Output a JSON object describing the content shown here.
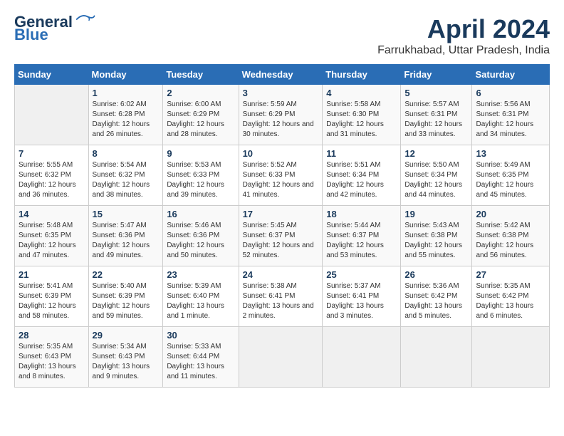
{
  "header": {
    "logo_line1": "General",
    "logo_line2": "Blue",
    "month": "April 2024",
    "location": "Farrukhabad, Uttar Pradesh, India"
  },
  "days_of_week": [
    "Sunday",
    "Monday",
    "Tuesday",
    "Wednesday",
    "Thursday",
    "Friday",
    "Saturday"
  ],
  "weeks": [
    [
      {
        "day": "",
        "empty": true
      },
      {
        "day": "1",
        "sunrise": "Sunrise: 6:02 AM",
        "sunset": "Sunset: 6:28 PM",
        "daylight": "Daylight: 12 hours and 26 minutes."
      },
      {
        "day": "2",
        "sunrise": "Sunrise: 6:00 AM",
        "sunset": "Sunset: 6:29 PM",
        "daylight": "Daylight: 12 hours and 28 minutes."
      },
      {
        "day": "3",
        "sunrise": "Sunrise: 5:59 AM",
        "sunset": "Sunset: 6:29 PM",
        "daylight": "Daylight: 12 hours and 30 minutes."
      },
      {
        "day": "4",
        "sunrise": "Sunrise: 5:58 AM",
        "sunset": "Sunset: 6:30 PM",
        "daylight": "Daylight: 12 hours and 31 minutes."
      },
      {
        "day": "5",
        "sunrise": "Sunrise: 5:57 AM",
        "sunset": "Sunset: 6:31 PM",
        "daylight": "Daylight: 12 hours and 33 minutes."
      },
      {
        "day": "6",
        "sunrise": "Sunrise: 5:56 AM",
        "sunset": "Sunset: 6:31 PM",
        "daylight": "Daylight: 12 hours and 34 minutes."
      }
    ],
    [
      {
        "day": "7",
        "sunrise": "Sunrise: 5:55 AM",
        "sunset": "Sunset: 6:32 PM",
        "daylight": "Daylight: 12 hours and 36 minutes."
      },
      {
        "day": "8",
        "sunrise": "Sunrise: 5:54 AM",
        "sunset": "Sunset: 6:32 PM",
        "daylight": "Daylight: 12 hours and 38 minutes."
      },
      {
        "day": "9",
        "sunrise": "Sunrise: 5:53 AM",
        "sunset": "Sunset: 6:33 PM",
        "daylight": "Daylight: 12 hours and 39 minutes."
      },
      {
        "day": "10",
        "sunrise": "Sunrise: 5:52 AM",
        "sunset": "Sunset: 6:33 PM",
        "daylight": "Daylight: 12 hours and 41 minutes."
      },
      {
        "day": "11",
        "sunrise": "Sunrise: 5:51 AM",
        "sunset": "Sunset: 6:34 PM",
        "daylight": "Daylight: 12 hours and 42 minutes."
      },
      {
        "day": "12",
        "sunrise": "Sunrise: 5:50 AM",
        "sunset": "Sunset: 6:34 PM",
        "daylight": "Daylight: 12 hours and 44 minutes."
      },
      {
        "day": "13",
        "sunrise": "Sunrise: 5:49 AM",
        "sunset": "Sunset: 6:35 PM",
        "daylight": "Daylight: 12 hours and 45 minutes."
      }
    ],
    [
      {
        "day": "14",
        "sunrise": "Sunrise: 5:48 AM",
        "sunset": "Sunset: 6:35 PM",
        "daylight": "Daylight: 12 hours and 47 minutes."
      },
      {
        "day": "15",
        "sunrise": "Sunrise: 5:47 AM",
        "sunset": "Sunset: 6:36 PM",
        "daylight": "Daylight: 12 hours and 49 minutes."
      },
      {
        "day": "16",
        "sunrise": "Sunrise: 5:46 AM",
        "sunset": "Sunset: 6:36 PM",
        "daylight": "Daylight: 12 hours and 50 minutes."
      },
      {
        "day": "17",
        "sunrise": "Sunrise: 5:45 AM",
        "sunset": "Sunset: 6:37 PM",
        "daylight": "Daylight: 12 hours and 52 minutes."
      },
      {
        "day": "18",
        "sunrise": "Sunrise: 5:44 AM",
        "sunset": "Sunset: 6:37 PM",
        "daylight": "Daylight: 12 hours and 53 minutes."
      },
      {
        "day": "19",
        "sunrise": "Sunrise: 5:43 AM",
        "sunset": "Sunset: 6:38 PM",
        "daylight": "Daylight: 12 hours and 55 minutes."
      },
      {
        "day": "20",
        "sunrise": "Sunrise: 5:42 AM",
        "sunset": "Sunset: 6:38 PM",
        "daylight": "Daylight: 12 hours and 56 minutes."
      }
    ],
    [
      {
        "day": "21",
        "sunrise": "Sunrise: 5:41 AM",
        "sunset": "Sunset: 6:39 PM",
        "daylight": "Daylight: 12 hours and 58 minutes."
      },
      {
        "day": "22",
        "sunrise": "Sunrise: 5:40 AM",
        "sunset": "Sunset: 6:39 PM",
        "daylight": "Daylight: 12 hours and 59 minutes."
      },
      {
        "day": "23",
        "sunrise": "Sunrise: 5:39 AM",
        "sunset": "Sunset: 6:40 PM",
        "daylight": "Daylight: 13 hours and 1 minute."
      },
      {
        "day": "24",
        "sunrise": "Sunrise: 5:38 AM",
        "sunset": "Sunset: 6:41 PM",
        "daylight": "Daylight: 13 hours and 2 minutes."
      },
      {
        "day": "25",
        "sunrise": "Sunrise: 5:37 AM",
        "sunset": "Sunset: 6:41 PM",
        "daylight": "Daylight: 13 hours and 3 minutes."
      },
      {
        "day": "26",
        "sunrise": "Sunrise: 5:36 AM",
        "sunset": "Sunset: 6:42 PM",
        "daylight": "Daylight: 13 hours and 5 minutes."
      },
      {
        "day": "27",
        "sunrise": "Sunrise: 5:35 AM",
        "sunset": "Sunset: 6:42 PM",
        "daylight": "Daylight: 13 hours and 6 minutes."
      }
    ],
    [
      {
        "day": "28",
        "sunrise": "Sunrise: 5:35 AM",
        "sunset": "Sunset: 6:43 PM",
        "daylight": "Daylight: 13 hours and 8 minutes."
      },
      {
        "day": "29",
        "sunrise": "Sunrise: 5:34 AM",
        "sunset": "Sunset: 6:43 PM",
        "daylight": "Daylight: 13 hours and 9 minutes."
      },
      {
        "day": "30",
        "sunrise": "Sunrise: 5:33 AM",
        "sunset": "Sunset: 6:44 PM",
        "daylight": "Daylight: 13 hours and 11 minutes."
      },
      {
        "day": "",
        "empty": true
      },
      {
        "day": "",
        "empty": true
      },
      {
        "day": "",
        "empty": true
      },
      {
        "day": "",
        "empty": true
      }
    ]
  ]
}
